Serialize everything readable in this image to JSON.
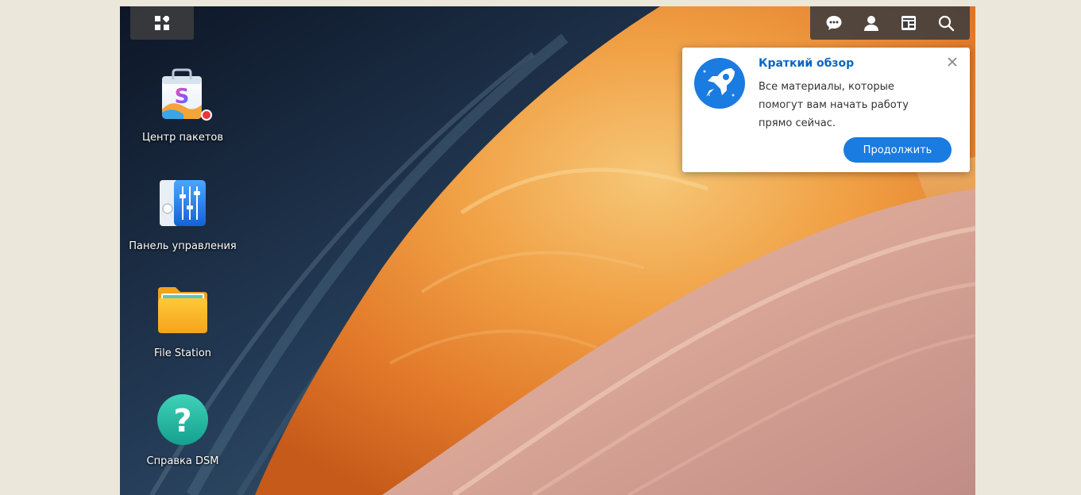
{
  "desktop": {
    "icons": [
      {
        "label": "Центр пакетов",
        "icon": "package-center-icon",
        "badge": true
      },
      {
        "label": "Панель управления",
        "icon": "control-panel-icon"
      },
      {
        "label": "File Station",
        "icon": "folder-icon"
      },
      {
        "label": "Справка DSM",
        "icon": "help-icon"
      }
    ]
  },
  "taskbar": {
    "icons": [
      "chat-icon",
      "user-icon",
      "widgets-icon",
      "search-icon"
    ]
  },
  "quick_start": {
    "title": "Краткий обзор",
    "body": "Все материалы, которые помогут вам начать работу прямо сейчас.",
    "continue_label": "Продолжить",
    "icon": "rocket-icon"
  },
  "colors": {
    "accent": "#1a7be0",
    "title": "#0a66c2",
    "badge": "#e8383d"
  }
}
